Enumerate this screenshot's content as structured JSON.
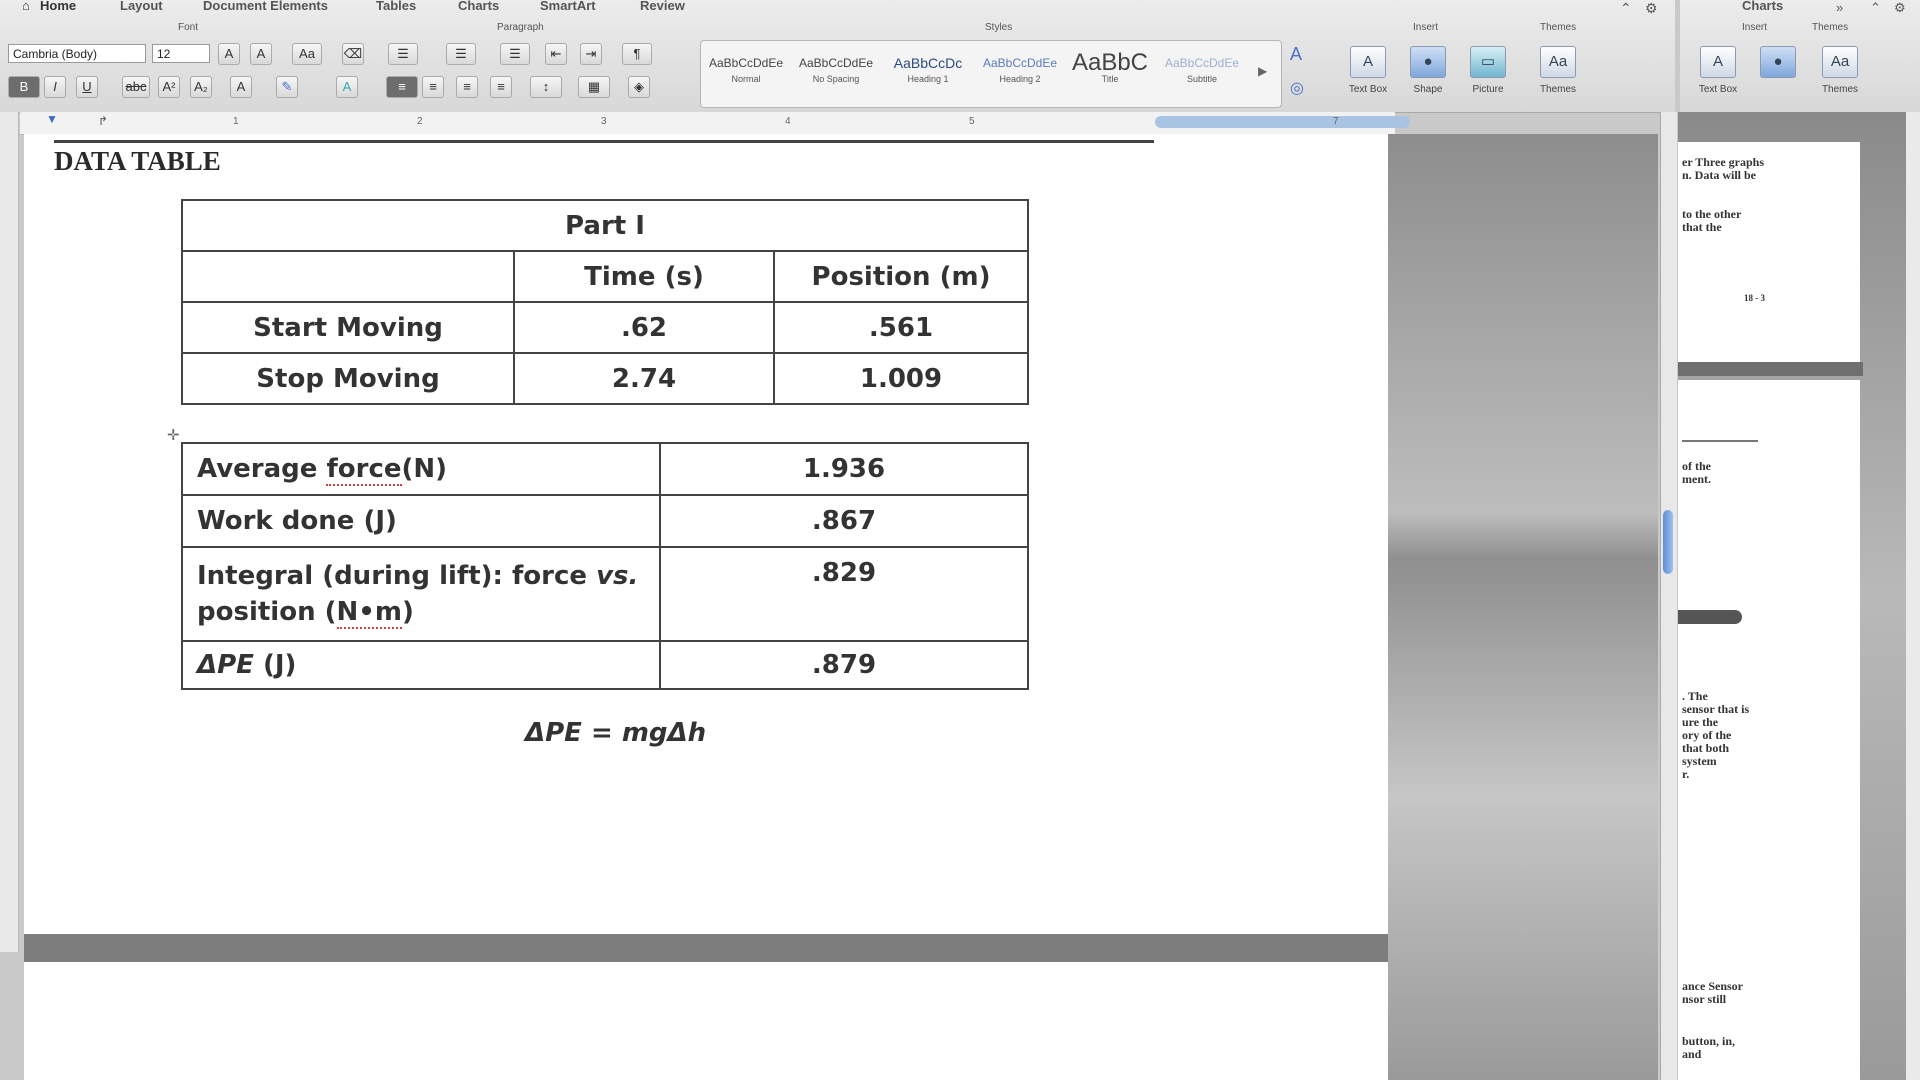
{
  "ribbon": {
    "tabs": [
      "Home",
      "Layout",
      "Document Elements",
      "Tables",
      "Charts",
      "SmartArt",
      "Review"
    ],
    "groups": {
      "font": "Font",
      "paragraph": "Paragraph",
      "styles": "Styles",
      "insert": "Insert",
      "themes": "Themes"
    },
    "font_name": "Cambria (Body)",
    "font_size": "12",
    "styles": [
      {
        "sample": "AaBbCcDdEe",
        "name": "Normal"
      },
      {
        "sample": "AaBbCcDdEe",
        "name": "No Spacing"
      },
      {
        "sample": "AaBbCcDc",
        "name": "Heading 1"
      },
      {
        "sample": "AaBbCcDdEe",
        "name": "Heading 2"
      },
      {
        "sample": "AaBbC",
        "name": "Title"
      },
      {
        "sample": "AaBbCcDdEe",
        "name": "Subtitle"
      }
    ],
    "insert_buttons": [
      "Text Box",
      "Shape",
      "Picture"
    ],
    "themes_button": "Themes"
  },
  "side_ribbon": {
    "tab": "Charts",
    "groups": {
      "insert": "Insert",
      "themes": "Themes"
    },
    "buttons": [
      "Text Box",
      "Themes"
    ]
  },
  "ruler": {
    "numbers": [
      "1",
      "2",
      "3",
      "4",
      "5",
      "7"
    ]
  },
  "document": {
    "heading": "DATA TABLE",
    "table1": {
      "title": "Part I",
      "col_headers": [
        "",
        "Time (s)",
        "Position (m)"
      ],
      "rows": [
        {
          "label": "Start Moving",
          "time": ".62",
          "position": ".561"
        },
        {
          "label": "Stop Moving",
          "time": "2.74",
          "position": "1.009"
        }
      ]
    },
    "table2": {
      "rows": [
        {
          "label_pre": "Average ",
          "label_squig": "force",
          "label_post": "(N)",
          "value": "1.936"
        },
        {
          "label_pre": "Work done (J)",
          "label_squig": "",
          "label_post": "",
          "value": ".867"
        },
        {
          "label_line1": "Integral (during lift): force ",
          "label_line1_italic": "vs.",
          "label_line2_pre": "position (",
          "label_line2_squig": "N•m",
          "label_line2_post": ")",
          "value": ".829"
        },
        {
          "label_pre": "ΔPE",
          "label_squig": "",
          "label_post": " (J)",
          "value": ".879"
        }
      ]
    },
    "formula": "ΔPE = mgΔh"
  },
  "thumbnails": {
    "page1_lines": [
      "er Three graphs",
      "n. Data will be",
      "",
      "to the other",
      "that the",
      "",
      "18 - 3"
    ],
    "page2_lines": [
      "of the",
      "ment.",
      "",
      "",
      "",
      ". The",
      "sensor that is",
      "ure the",
      "ory of the",
      "that both",
      "system",
      "r.",
      "",
      "",
      "",
      "",
      "",
      "ance Sensor",
      "nsor still",
      "",
      "button, in,",
      "and"
    ]
  },
  "colors": {
    "page": "#ffffff",
    "workspace": "#9a9a9a",
    "scroll_thumb": "#5d8fd4",
    "table_border": "#444444"
  }
}
